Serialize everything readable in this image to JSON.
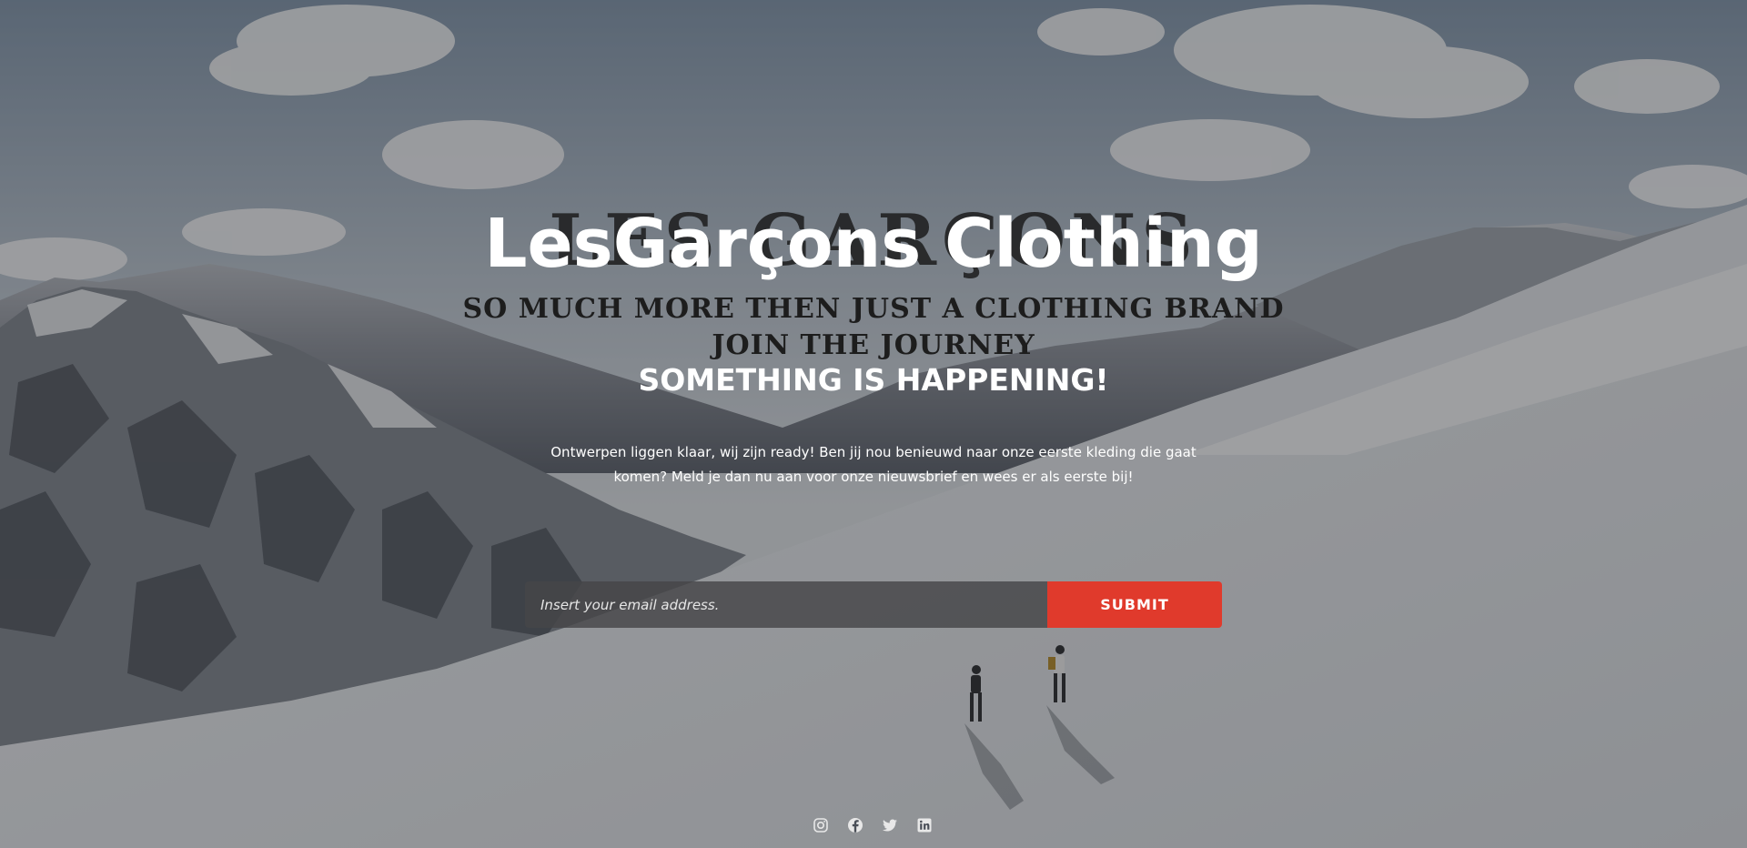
{
  "brand": {
    "logo_text": "Les Garçons",
    "title": "LesGarçons Clothing"
  },
  "hero": {
    "tagline_1": "So much more then just a clothing brand",
    "tagline_2": "Join the journey",
    "subtitle": "SOMETHING IS HAPPENING!",
    "description": "Ontwerpen liggen klaar, wij zijn ready! Ben jij nou benieuwd naar onze eerste kleding die gaat komen? Meld je dan nu aan voor onze nieuwsbrief en wees er als eerste bij!"
  },
  "signup": {
    "email_placeholder": "Insert your email address.",
    "email_value": "",
    "submit_label": "SUBMIT"
  },
  "social": [
    {
      "icon": "instagram-icon"
    },
    {
      "icon": "facebook-icon"
    },
    {
      "icon": "twitter-icon"
    },
    {
      "icon": "linkedin-icon"
    }
  ],
  "colors": {
    "accent": "#e03a2c",
    "text": "#ffffff",
    "tagline": "#1d1d1d",
    "input_bg": "#464648"
  }
}
